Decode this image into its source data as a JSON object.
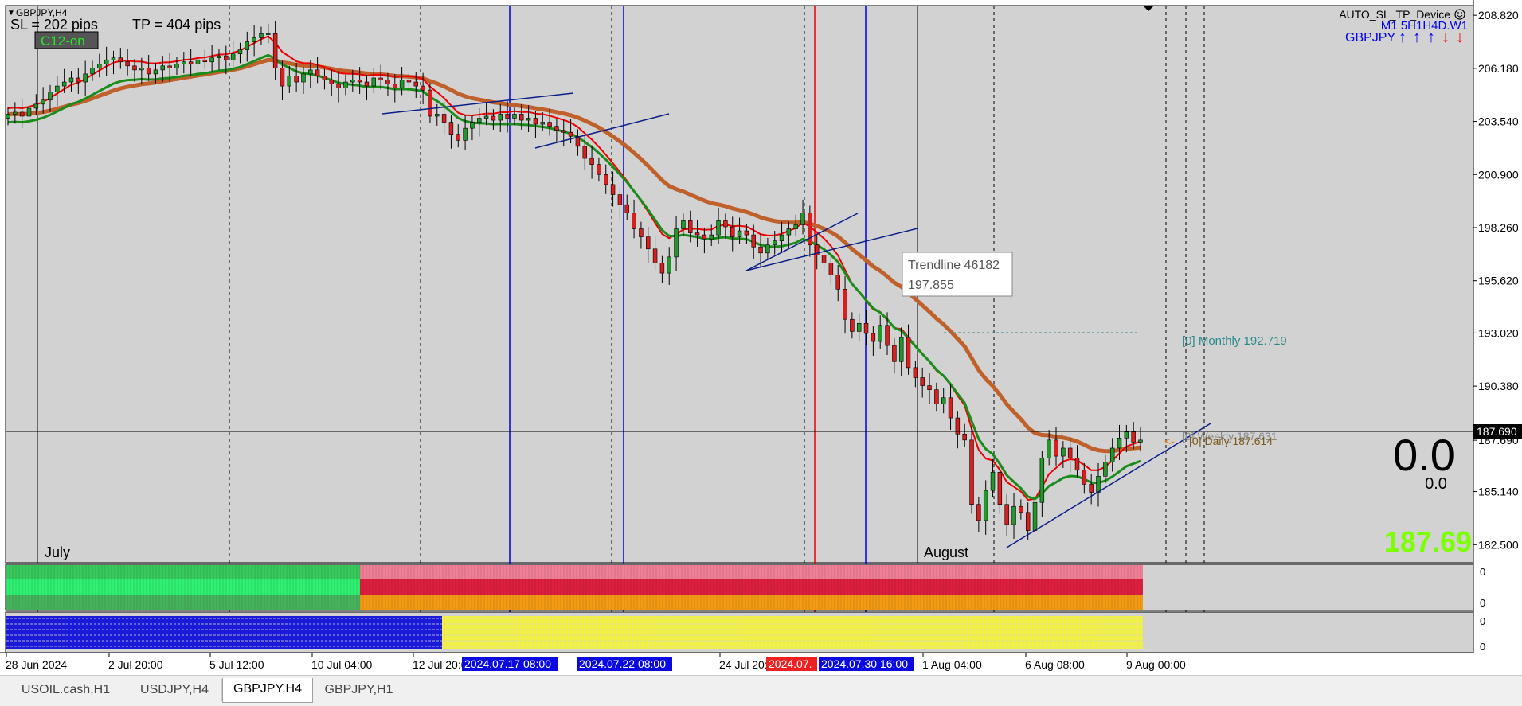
{
  "symbol_label": "GBPJPY,H4",
  "sl_text": "SL = 202 pips",
  "tp_text": "TP = 404 pips",
  "c12_badge": "C12-on",
  "device_title": "AUTO_SL_TP_Device",
  "timeframes_label": "M1 5H1H4D.W1",
  "pair_label": "GBPJPY",
  "trend_arrows": [
    "up",
    "up",
    "up",
    "down",
    "down"
  ],
  "tooltip": {
    "title": "Trendline 46182",
    "value": "197.855"
  },
  "monthly_label": "[0] Monthly 192.719",
  "daily_label": "[0] Daily 187.614",
  "overlap_label": "[0] Weekly 187.631",
  "big_value": "0.0",
  "small_value": "0.0",
  "price_value": "187.69",
  "current_price": "187.690",
  "month_labels": [
    "July",
    "August"
  ],
  "indicator_zero": "0",
  "colors": {
    "bg": "#d2d2d2",
    "ma_fast": "#ee0000",
    "ma_slow": "#c0602a",
    "ma_green": "#1a8c1a",
    "bull": "#1f9a2a",
    "bear": "#d81e1e",
    "vline_blue": "#0000ee",
    "vline_red": "#ee0000",
    "trend": "#0b1f8a",
    "price_green": "#7cff00"
  },
  "tabs": [
    {
      "label": "USOIL.cash,H1",
      "active": false
    },
    {
      "label": "USDJPY,H4",
      "active": false
    },
    {
      "label": "GBPJPY,H4",
      "active": true
    },
    {
      "label": "GBPJPY,H1",
      "active": false
    }
  ],
  "chart_data": {
    "type": "candlestick",
    "y_ticks": [
      "208.820",
      "206.180",
      "203.540",
      "200.900",
      "198.260",
      "195.620",
      "193.020",
      "190.380",
      "187.690",
      "185.140",
      "182.500"
    ],
    "ylim": [
      181.6,
      209.3
    ],
    "x_ticks": [
      "28 Jun 2024",
      "2 Jul 20:00",
      "5 Jul 12:00",
      "10 Jul 04:00",
      "12 Jul 20:00",
      "24 Jul 20:00",
      "1 Aug 04:00",
      "6 Aug 08:00",
      "9 Aug 00:00"
    ],
    "vertical_line_labels": [
      {
        "text": "2024.07.17 08:00",
        "color": "blue"
      },
      {
        "text": "2024.07.22 08:00",
        "color": "blue"
      },
      {
        "text": "2024.07.",
        "color": "red"
      },
      {
        "text": "2024.07.30 16:00",
        "color": "blue"
      }
    ],
    "close": [
      203.9,
      204.0,
      203.8,
      204.2,
      204.4,
      204.6,
      205.0,
      205.3,
      205.5,
      205.7,
      205.5,
      205.9,
      206.2,
      206.4,
      206.6,
      206.7,
      206.5,
      206.3,
      206.1,
      206.2,
      205.9,
      206.1,
      206.3,
      206.2,
      206.4,
      206.5,
      206.4,
      206.6,
      206.5,
      206.7,
      206.8,
      206.6,
      206.9,
      207.1,
      207.5,
      207.7,
      207.9,
      207.9,
      206.2,
      205.3,
      205.8,
      205.5,
      205.9,
      206.1,
      205.8,
      205.6,
      205.4,
      205.2,
      205.5,
      205.6,
      205.5,
      205.3,
      205.7,
      205.6,
      205.4,
      205.2,
      205.6,
      205.5,
      205.3,
      205.1,
      203.8,
      203.9,
      203.5,
      202.9,
      202.6,
      203.2,
      203.5,
      203.7,
      203.8,
      203.6,
      203.9,
      203.7,
      203.9,
      203.6,
      203.7,
      203.4,
      203.5,
      203.3,
      203.1,
      203.0,
      202.8,
      202.3,
      201.7,
      201.4,
      200.9,
      200.4,
      199.9,
      199.4,
      199.0,
      198.2,
      197.8,
      197.2,
      196.5,
      196.0,
      196.8,
      198.2,
      198.6,
      198.0,
      197.9,
      197.7,
      197.9,
      198.6,
      198.3,
      197.8,
      198.1,
      197.9,
      197.3,
      197.0,
      197.4,
      197.6,
      197.9,
      198.2,
      198.4,
      199.0,
      197.4,
      196.9,
      196.5,
      195.9,
      195.2,
      193.7,
      193.1,
      193.5,
      193.0,
      192.6,
      193.4,
      192.4,
      191.6,
      192.8,
      191.3,
      190.8,
      190.4,
      190.2,
      189.5,
      189.8,
      188.8,
      188.0,
      187.7,
      184.5,
      183.7,
      185.2,
      186.1,
      184.5,
      183.5,
      184.4,
      184.1,
      183.2,
      184.6,
      186.8,
      187.7,
      186.9,
      187.3,
      186.8,
      186.2,
      185.5,
      185.1,
      185.9,
      186.6,
      187.3,
      187.8,
      188.1,
      187.6,
      187.7
    ],
    "series": [
      {
        "name": "ma_fast",
        "color": "#ee0000"
      },
      {
        "name": "ma_slow",
        "color": "#c0602a"
      },
      {
        "name": "ma_green",
        "color": "#1a8c1a"
      }
    ]
  }
}
